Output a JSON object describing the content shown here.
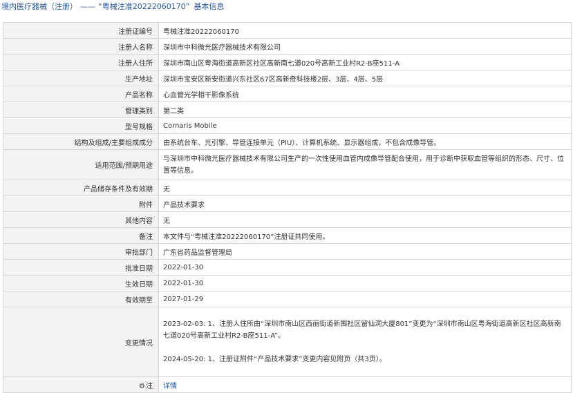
{
  "header": {
    "category": "境内医疗器械（注册）",
    "dash": "——",
    "record_title": "“粤械注准20222060170”",
    "suffix": "基本信息"
  },
  "rows": [
    {
      "label": "注册证编号",
      "value": "粤械注准20222060170"
    },
    {
      "label": "注册人名称",
      "value": "深圳市中科微光医疗器械技术有限公司"
    },
    {
      "label": "注册人住所",
      "value": "深圳市南山区粤海街道高新区社区高新南七道020号高新工业村R2-B座511-A"
    },
    {
      "label": "生产地址",
      "value": "深圳市宝安区新安街道兴东社区67区高新奇科技楼2层、3层、4层、5层"
    },
    {
      "label": "产品名称",
      "value": "心血管光学相干影像系统"
    },
    {
      "label": "管理类别",
      "value": "第二类"
    },
    {
      "label": "型号规格",
      "value": "Cornaris Mobile"
    },
    {
      "label": "结构及组成/主要组成成分",
      "value": "由系统台车、光引擎、导管连接单元（PIU）、计算机系统、显示器组成，不包含成像导管。"
    },
    {
      "label": "适用范围/预期用途",
      "value": "与深圳市中科微光医疗器械技术有限公司生产的一次性使用血管内成像导管配合使用，用于诊断中获取血管等组织的形态、尺寸、位置等信息。"
    },
    {
      "label": "产品储存条件及有效期",
      "value": "无"
    },
    {
      "label": "附件",
      "value": "产品技术要求"
    },
    {
      "label": "其他内容",
      "value": "无"
    },
    {
      "label": "备注",
      "value": "本文件与“粤械注准20222060170”注册证共同使用。"
    },
    {
      "label": "审批部门",
      "value": "广东省药品监督管理局"
    },
    {
      "label": "批准日期",
      "value": "2022-01-30"
    },
    {
      "label": "生效日期",
      "value": "2022-01-30"
    },
    {
      "label": "有效期至",
      "value": "2027-01-29"
    }
  ],
  "changes": {
    "label": "变更情况",
    "entries": [
      "2023-02-03: 1、注册人住所由“深圳市南山区西丽街道新围社区留仙洞大厦801”变更为“深圳市南山区粤海街道高新区社区高新南七道020号高新工业村R2-B座511-A”。",
      "2024-05-20: 1、注册证附件“产品技术要求”变更内容见附页（共3页）。"
    ]
  },
  "note_row": {
    "label": "注",
    "icon": "gear-icon",
    "link_text": "详情"
  },
  "colors": {
    "link": "#2455a8",
    "label_bg": "#f3f3f3",
    "border": "#d6d6d6"
  }
}
